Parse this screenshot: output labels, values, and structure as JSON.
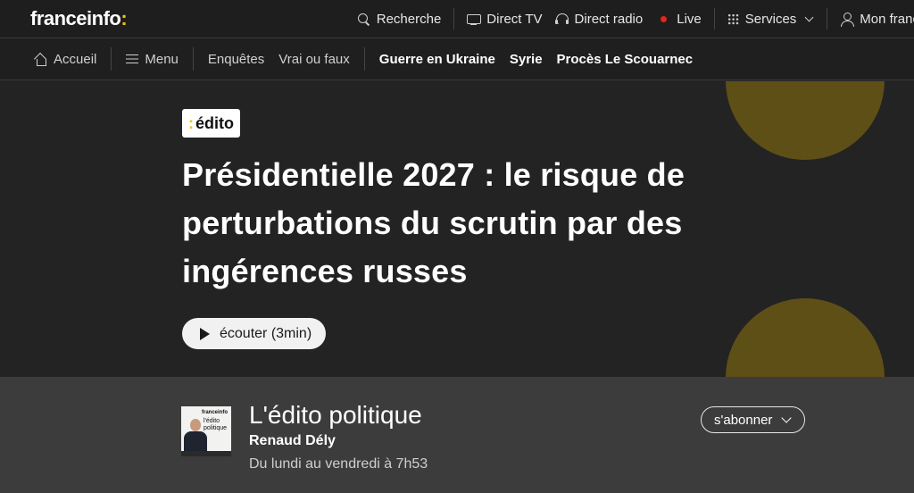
{
  "brand": {
    "name": "franceinfo",
    "colon": ":"
  },
  "top_nav": {
    "search": "Recherche",
    "direct_tv": "Direct TV",
    "direct_radio": "Direct radio",
    "live": "Live",
    "services": "Services",
    "account": "Mon franc"
  },
  "sub_nav": {
    "home": "Accueil",
    "menu": "Menu",
    "items": [
      "Enquêtes",
      "Vrai ou faux"
    ],
    "hot_topics": [
      "Guerre en Ukraine",
      "Syrie",
      "Procès Le Scouarnec"
    ]
  },
  "article": {
    "badge_colon": ":",
    "badge_label": "édito",
    "title": "Présidentielle 2027 : le risque de perturbations du scrutin par des ingérences russes",
    "listen_label": "écouter (3min)"
  },
  "program": {
    "thumb_brand": "franceinfo",
    "thumb_title": "l'édito politique",
    "title": "L'édito politique",
    "author": "Renaud Dély",
    "schedule": "Du lundi au vendredi à 7h53",
    "subscribe_label": "s'abonner"
  },
  "colors": {
    "accent": "#f4c300",
    "live": "#e4251b",
    "circle": "#5e4f17"
  }
}
